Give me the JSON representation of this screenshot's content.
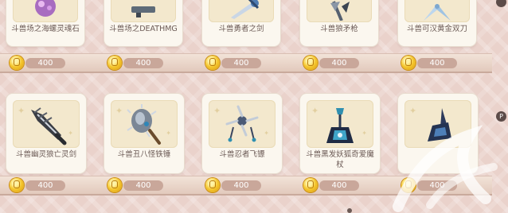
{
  "shop": {
    "currency_icon": "gold-coin-icon",
    "rows": [
      {
        "items": [
          {
            "name": "斗兽场之海螺灵魂石",
            "price": "400",
            "icon": "conch-soul-stone-icon",
            "accent": "#8e5aa8"
          },
          {
            "name": "斗兽场之DEATHMG",
            "price": "400",
            "icon": "machine-gun-icon",
            "accent": "#5e6b78"
          },
          {
            "name": "斗兽勇者之剑",
            "price": "400",
            "icon": "brave-sword-icon",
            "accent": "#4e7bb0"
          },
          {
            "name": "斗兽狼矛枪",
            "price": "400",
            "icon": "wolf-spear-icon",
            "accent": "#556070"
          },
          {
            "name": "斗兽可汉黄金双刀",
            "price": "400",
            "icon": "golden-twin-blades-icon",
            "accent": "#7da7cf"
          }
        ]
      },
      {
        "items": [
          {
            "name": "斗兽幽灵狼亡灵剑",
            "price": "400",
            "icon": "ghost-wolf-sword-icon",
            "accent": "#3a3d44"
          },
          {
            "name": "斗兽丑八怪铁锤",
            "price": "400",
            "icon": "spiked-hammer-icon",
            "accent": "#6f7c8c"
          },
          {
            "name": "斗兽忍者飞镖",
            "price": "400",
            "icon": "ninja-shuriken-icon",
            "accent": "#4a5a76"
          },
          {
            "name": "斗兽黑发妖狐奇爱魔杖",
            "price": "400",
            "icon": "fox-magic-wand-icon",
            "accent": "#2f8fb0"
          },
          {
            "name": "",
            "price": "400",
            "icon": "dark-lance-icon",
            "accent": "#2c3a5c"
          }
        ]
      }
    ]
  },
  "scroll_marker": "P",
  "watermark": "watermark-logo-icon"
}
